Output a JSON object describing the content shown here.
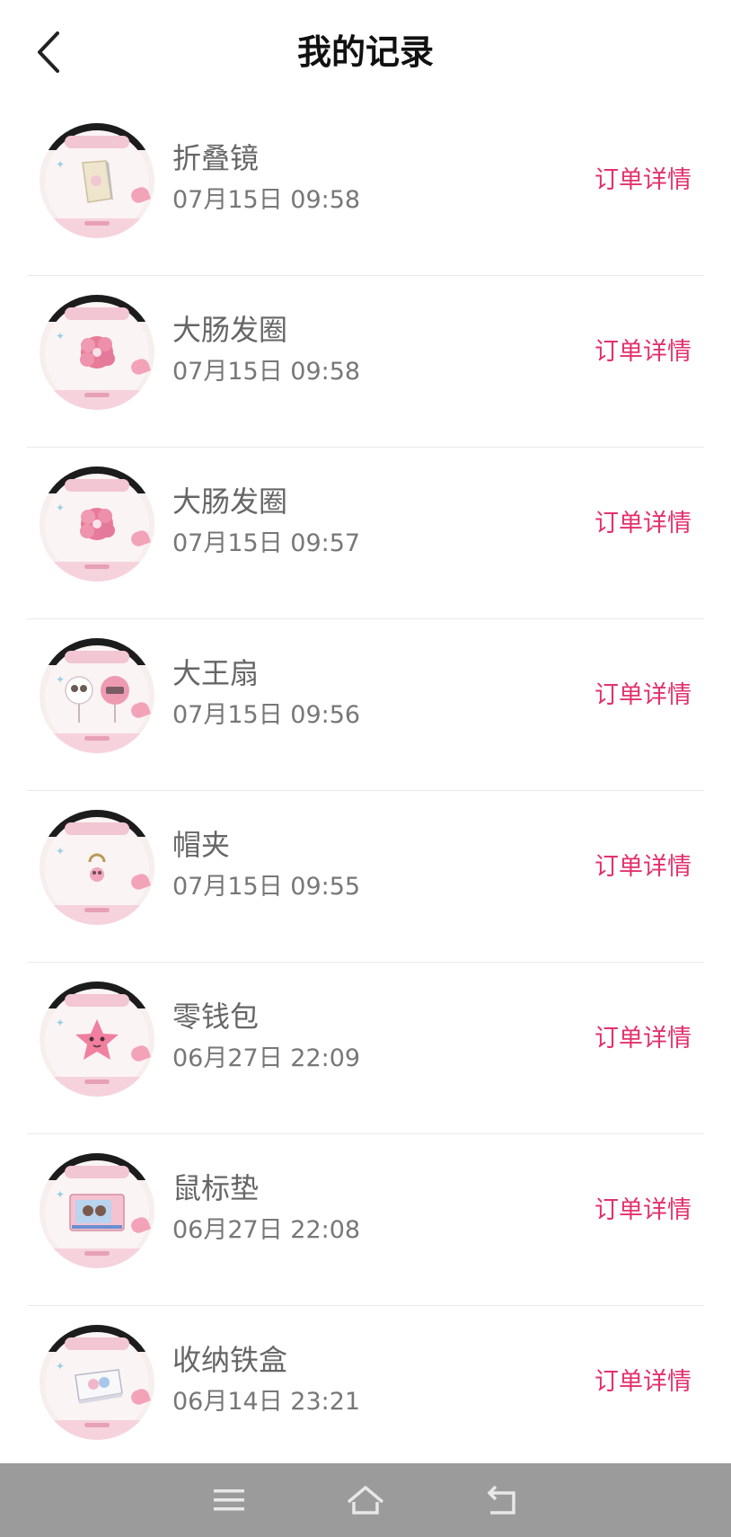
{
  "header": {
    "title": "我的记录"
  },
  "detail_label": "订单详情",
  "records": [
    {
      "name": "折叠镜",
      "time": "07月15日 09:58",
      "product": "folding-mirror"
    },
    {
      "name": "大肠发圈",
      "time": "07月15日 09:58",
      "product": "scrunchie"
    },
    {
      "name": "大肠发圈",
      "time": "07月15日 09:57",
      "product": "scrunchie"
    },
    {
      "name": "大王扇",
      "time": "07月15日 09:56",
      "product": "fan"
    },
    {
      "name": "帽夹",
      "time": "07月15日 09:55",
      "product": "hat-clip"
    },
    {
      "name": "零钱包",
      "time": "06月27日 22:09",
      "product": "coin-purse"
    },
    {
      "name": "鼠标垫",
      "time": "06月27日 22:08",
      "product": "mouse-pad"
    },
    {
      "name": "收纳铁盒",
      "time": "06月14日 23:21",
      "product": "tin-box"
    }
  ],
  "colors": {
    "accent": "#e2326c",
    "navbar": "#9b9b9b"
  },
  "nav_icons": [
    "menu-icon",
    "home-icon",
    "back-nav-icon"
  ]
}
